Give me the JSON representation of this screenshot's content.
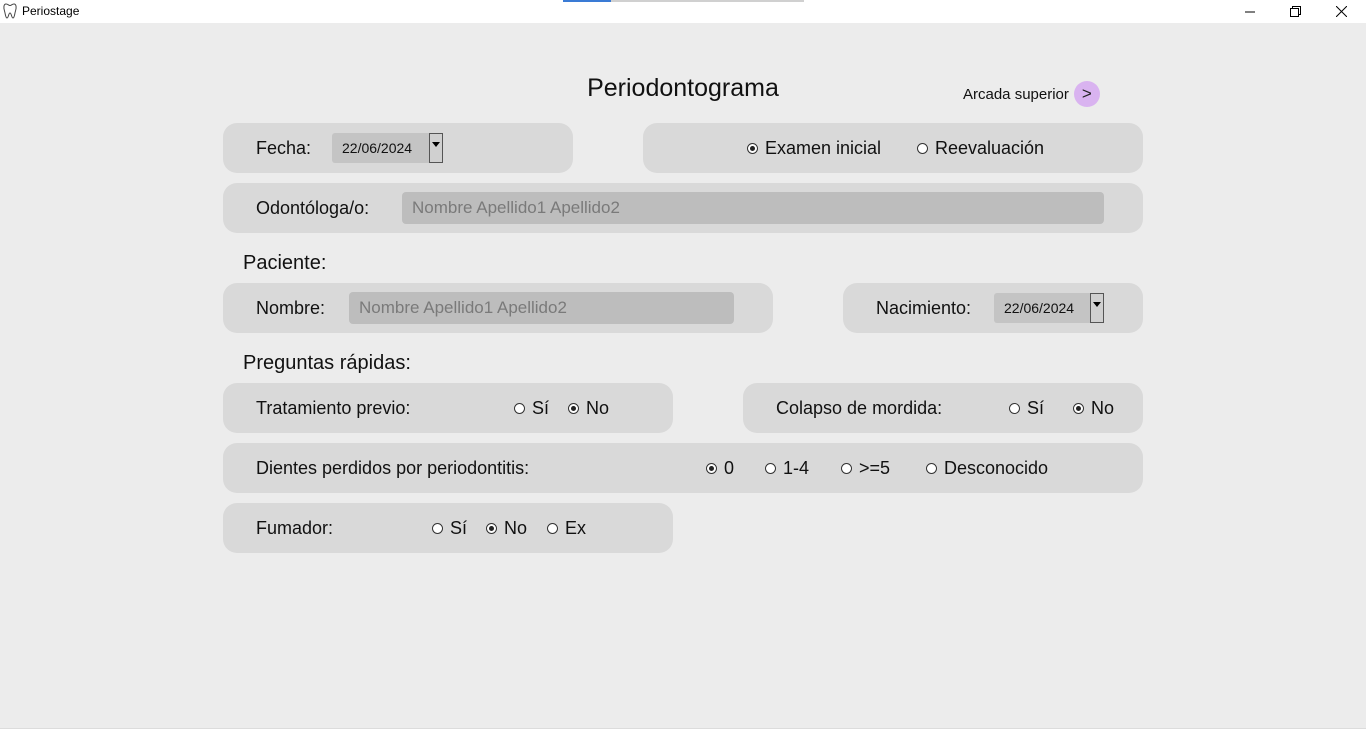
{
  "window": {
    "title": "Periostage",
    "icon": "tooth-icon"
  },
  "heading": "Periodontograma",
  "arcada": {
    "label": "Arcada superior",
    "button": ">"
  },
  "fecha": {
    "label": "Fecha:",
    "value": "22/06/2024"
  },
  "exam_type": {
    "options": [
      {
        "label": "Examen inicial",
        "selected": true
      },
      {
        "label": "Reevaluación",
        "selected": false
      }
    ]
  },
  "odontologa": {
    "label": "Odontóloga/o:",
    "placeholder": "Nombre Apellido1 Apellido2"
  },
  "paciente": {
    "section": "Paciente:",
    "nombre_label": "Nombre:",
    "nombre_placeholder": "Nombre Apellido1 Apellido2",
    "nacimiento_label": "Nacimiento:",
    "nacimiento_value": "22/06/2024"
  },
  "preguntas": {
    "section": "Preguntas rápidas:",
    "tratamiento": {
      "label": "Tratamiento previo:",
      "options": [
        {
          "label": "Sí",
          "selected": false
        },
        {
          "label": "No",
          "selected": true
        }
      ]
    },
    "colapso": {
      "label": "Colapso de mordida:",
      "options": [
        {
          "label": "Sí",
          "selected": false
        },
        {
          "label": "No",
          "selected": true
        }
      ]
    },
    "dientes": {
      "label": "Dientes perdidos por periodontitis:",
      "options": [
        {
          "label": "0",
          "selected": true
        },
        {
          "label": "1-4",
          "selected": false
        },
        {
          "label": ">=5",
          "selected": false
        },
        {
          "label": "Desconocido",
          "selected": false
        }
      ]
    },
    "fumador": {
      "label": "Fumador:",
      "options": [
        {
          "label": "Sí",
          "selected": false
        },
        {
          "label": "No",
          "selected": true
        },
        {
          "label": "Ex",
          "selected": false
        }
      ]
    }
  }
}
